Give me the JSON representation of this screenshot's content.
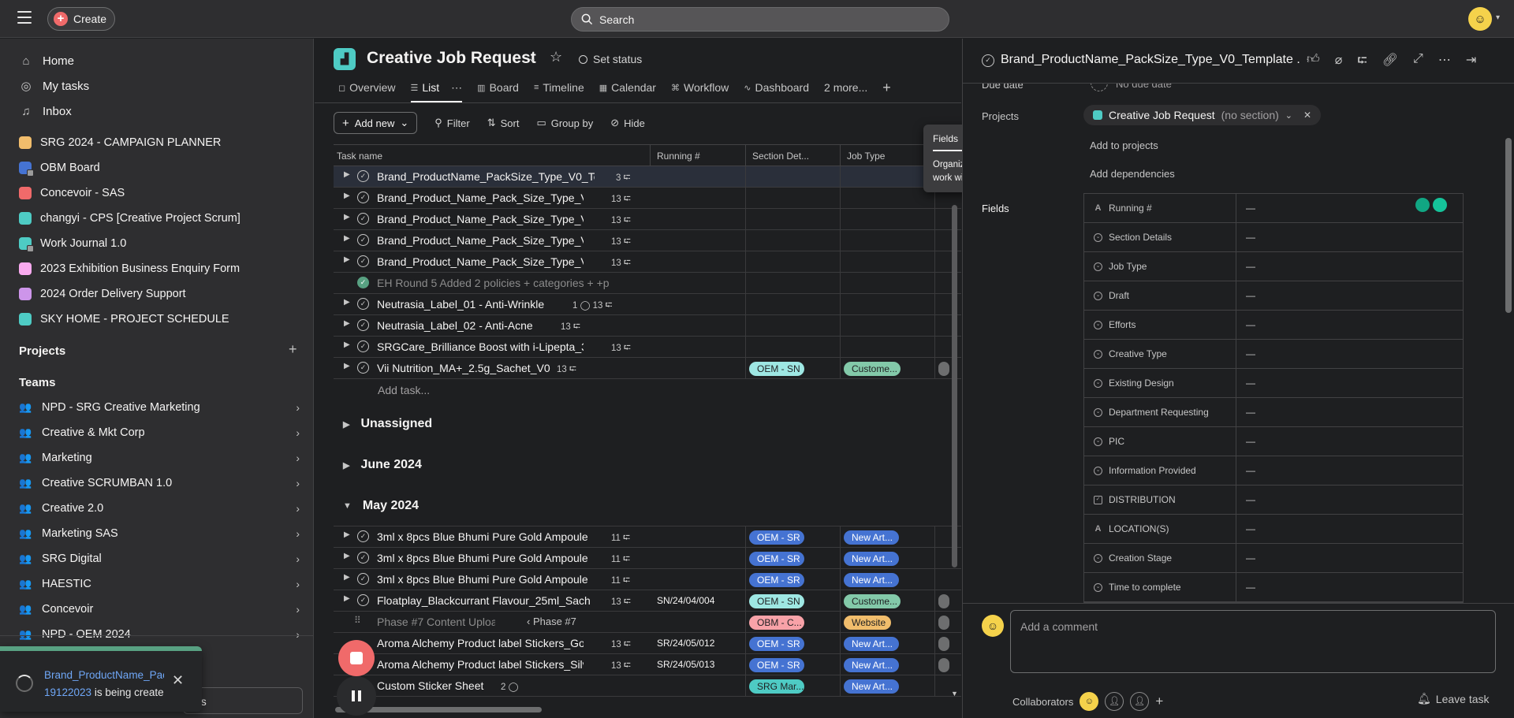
{
  "topbar": {
    "create_label": "Create",
    "search_placeholder": "Search"
  },
  "sidebar": {
    "nav": [
      {
        "label": "Home",
        "icon": "home-icon"
      },
      {
        "label": "My tasks",
        "icon": "check-circle-icon"
      },
      {
        "label": "Inbox",
        "icon": "bell-icon"
      }
    ],
    "starred": [
      {
        "label": "SRG 2024 - CAMPAIGN PLANNER",
        "color": "#f1bd6c",
        "lock": false
      },
      {
        "label": "OBM Board",
        "color": "#4573d2",
        "lock": true
      },
      {
        "label": "Concevoir - SAS",
        "color": "#f06a6a",
        "lock": false
      },
      {
        "label": "changyi - CPS [Creative Project Scrum]",
        "color": "#4ecbc4",
        "lock": false
      },
      {
        "label": "Work Journal 1.0",
        "color": "#4ecbc4",
        "lock": true
      },
      {
        "label": "2023 Exhibition Business Enquiry Form",
        "color": "#f9aaef",
        "lock": false
      },
      {
        "label": "2024 Order Delivery Support",
        "color": "#cd95ea",
        "lock": false
      },
      {
        "label": "SKY HOME - PROJECT SCHEDULE",
        "color": "#4ecbc4",
        "lock": false
      }
    ],
    "projects_title": "Projects",
    "teams_title": "Teams",
    "teams": [
      "NPD - SRG Creative Marketing",
      "Creative & Mkt Corp",
      "Marketing",
      "Creative SCRUMBAN 1.0",
      "Creative 2.0",
      "Marketing SAS",
      "SRG Digital",
      "HAESTIC",
      "Concevoir",
      "NPD - OEM 2024"
    ],
    "bottom_input_text": "es"
  },
  "toast": {
    "link_line": "Brand_ProductName_Pac",
    "id": "19122023",
    "tail": " is being create"
  },
  "project": {
    "title": "Creative Job Request",
    "set_status": "Set status",
    "tabs": [
      {
        "label": "Overview",
        "icon": "◻"
      },
      {
        "label": "List",
        "icon": "☰",
        "active": true
      },
      {
        "label": "Board",
        "icon": "▥"
      },
      {
        "label": "Timeline",
        "icon": "≡"
      },
      {
        "label": "Calendar",
        "icon": "▦"
      },
      {
        "label": "Workflow",
        "icon": "⌘"
      },
      {
        "label": "Dashboard",
        "icon": "∿"
      },
      {
        "label": "2 more...",
        "icon": ""
      }
    ],
    "toolbar": {
      "add_new": "Add new",
      "filter": "Filter",
      "sort": "Sort",
      "group_by": "Group by",
      "hide": "Hide"
    },
    "columns": [
      "Task name",
      "Running #",
      "Section Det...",
      "Job Type"
    ],
    "tasks_top": [
      {
        "name": "Brand_ProductName_PackSize_Type_V0_Template",
        "meta": "3 ⮓",
        "done": false,
        "caret": true,
        "selected": true
      },
      {
        "name": "Brand_Product_Name_Pack_Size_Type_V0_",
        "meta": "13 ⮓",
        "done": false,
        "caret": true
      },
      {
        "name": "Brand_Product_Name_Pack_Size_Type_V0_",
        "meta": "13 ⮓",
        "done": false,
        "caret": true
      },
      {
        "name": "Brand_Product_Name_Pack_Size_Type_V0_",
        "meta": "13 ⮓",
        "done": false,
        "caret": true
      },
      {
        "name": "Brand_Product_Name_Pack_Size_Type_V0_",
        "meta": "13 ⮓",
        "done": false,
        "caret": true
      },
      {
        "name": "EH Round 5 Added 2 policies + categories + +p",
        "meta": "",
        "done": true,
        "caret": false,
        "muted": true
      },
      {
        "name": "Neutrasia_Label_01 - Anti-Wrinkle",
        "meta": "1 ◯  13 ⮓",
        "done": false,
        "caret": true
      },
      {
        "name": "Neutrasia_Label_02 - Anti-Acne",
        "meta": "13 ⮓",
        "done": false,
        "caret": true
      },
      {
        "name": "SRGCare_Brilliance Boost with i-Lipepta_3m",
        "meta": "13 ⮓",
        "done": false,
        "caret": true
      },
      {
        "name": "Vii Nutrition_MA+_2.5g_Sachet_V0",
        "meta": "13 ⮓",
        "done": false,
        "caret": true,
        "section": "OEM - SN",
        "job": "Custome..."
      }
    ],
    "add_task": "Add task...",
    "groups": [
      "Unassigned",
      "June 2024",
      "May 2024"
    ],
    "tasks_may": [
      {
        "name": "3ml x 8pcs Blue Bhumi Pure Gold Ampoule",
        "meta": "11 ⮓",
        "running": "",
        "section": "OEM - SR",
        "sec_style": "blue",
        "job": "New Art...",
        "job_style": "blue"
      },
      {
        "name": "3ml x 8pcs Blue Bhumi Pure Gold Ampoule",
        "meta": "11 ⮓",
        "running": "",
        "section": "OEM - SR",
        "sec_style": "blue",
        "job": "New Art...",
        "job_style": "blue"
      },
      {
        "name": "3ml x 8pcs Blue Bhumi Pure Gold Ampoule",
        "meta": "11 ⮓",
        "running": "",
        "section": "OEM - SR",
        "sec_style": "blue",
        "job": "New Art...",
        "job_style": "blue"
      },
      {
        "name": "Floatplay_Blackcurrant Flavour_25ml_Sache",
        "meta": "13 ⮓",
        "running": "SN/24/04/004",
        "section": "OEM - SN",
        "sec_style": "teal",
        "job": "Custome...",
        "job_style": "green"
      },
      {
        "name": "Phase #7 Content Upload",
        "meta": "‹ Phase #7",
        "running": "",
        "section": "OBM - C...",
        "sec_style": "pink",
        "job": "Website",
        "job_style": "gold",
        "muted": true,
        "subtask": true
      },
      {
        "name": "Aroma Alchemy Product label Stickers_Gol",
        "meta": "13 ⮓",
        "running": "SR/24/05/012",
        "section": "OEM - SR",
        "sec_style": "blue",
        "job": "New Art...",
        "job_style": "blue"
      },
      {
        "name": "Aroma Alchemy Product label Stickers_Silv",
        "meta": "13 ⮓",
        "running": "SR/24/05/013",
        "section": "OEM - SR",
        "sec_style": "blue",
        "job": "New Art...",
        "job_style": "blue"
      },
      {
        "name": "Custom Sticker Sheet",
        "meta": "2 ◯",
        "running": "",
        "section": "SRG Mar...",
        "sec_style": "tealdark",
        "job": "New Art...",
        "job_style": "blue",
        "nocheck": true
      }
    ]
  },
  "tooltip": {
    "title": "Fields",
    "body": "Organize and track your work with fields."
  },
  "detail": {
    "title": "Brand_ProductName_PackSize_Type_V0_Template ...",
    "due_label": "Due date",
    "due_value": "No due date",
    "projects_label": "Projects",
    "project_chip": "Creative Job Request",
    "project_section": "(no section)",
    "add_to_projects": "Add to projects",
    "add_dependencies": "Add dependencies",
    "fields_label": "Fields",
    "fields": [
      {
        "name": "Running #",
        "icon": "A",
        "value": "—"
      },
      {
        "name": "Section Details",
        "icon": "circle",
        "value": "—"
      },
      {
        "name": "Job Type",
        "icon": "circle",
        "value": "—"
      },
      {
        "name": "Draft",
        "icon": "circle",
        "value": "—"
      },
      {
        "name": "Efforts",
        "icon": "circle",
        "value": "—"
      },
      {
        "name": "Creative Type",
        "icon": "circle",
        "value": "—"
      },
      {
        "name": "Existing Design",
        "icon": "circle",
        "value": "—"
      },
      {
        "name": "Department Requesting",
        "icon": "circle",
        "value": "—"
      },
      {
        "name": "PIC",
        "icon": "circle",
        "value": "—"
      },
      {
        "name": "Information Provided",
        "icon": "circle",
        "value": "—"
      },
      {
        "name": "DISTRIBUTION",
        "icon": "square",
        "value": "—"
      },
      {
        "name": "LOCATION(S)",
        "icon": "A",
        "value": "—"
      },
      {
        "name": "Creation Stage",
        "icon": "circle",
        "value": "—"
      },
      {
        "name": "Time to complete",
        "icon": "circle",
        "value": "—"
      }
    ],
    "comment_placeholder": "Add a comment",
    "collaborators_label": "Collaborators",
    "leave_task": "Leave task"
  }
}
